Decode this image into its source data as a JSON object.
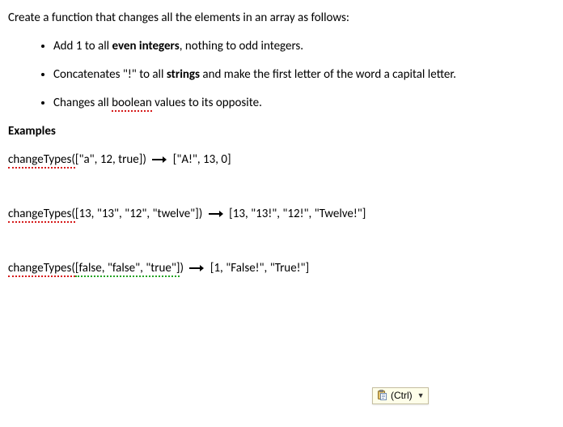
{
  "intro": "Create a function that changes all the elements in an array as follows:",
  "bullets": [
    {
      "pre": "Add 1 to all ",
      "bold": "even integers",
      "post": ", nothing to odd integers."
    },
    {
      "pre": "Concatenates \"!\" to all ",
      "bold": "strings",
      "post": " and make the first letter of the word a capital letter."
    },
    {
      "pre": "Changes all ",
      "underlined": "boolean",
      "post": " values to its opposite."
    }
  ],
  "examples_heading": "Examples",
  "examples": [
    {
      "fn_prefix": "changeTypes(",
      "fn_args": "[\"a\", 12, true]",
      "fn_close": ")",
      "result": "[\"A!\", 13, 0]"
    },
    {
      "fn_prefix": "changeTypes(",
      "fn_args": "[13, \"13\", \"12\", \"twelve\"]",
      "fn_close": ")",
      "result": "[13, \"13!\", \"12!\", \"Twelve!\"]"
    },
    {
      "fn_prefix": "changeTypes(",
      "fn_args": "[false, \"false\", \"true\"]",
      "fn_close": ")",
      "result": "[1, \"False!\", \"True!\"]"
    }
  ],
  "smarttag": {
    "label": "(Ctrl)"
  }
}
